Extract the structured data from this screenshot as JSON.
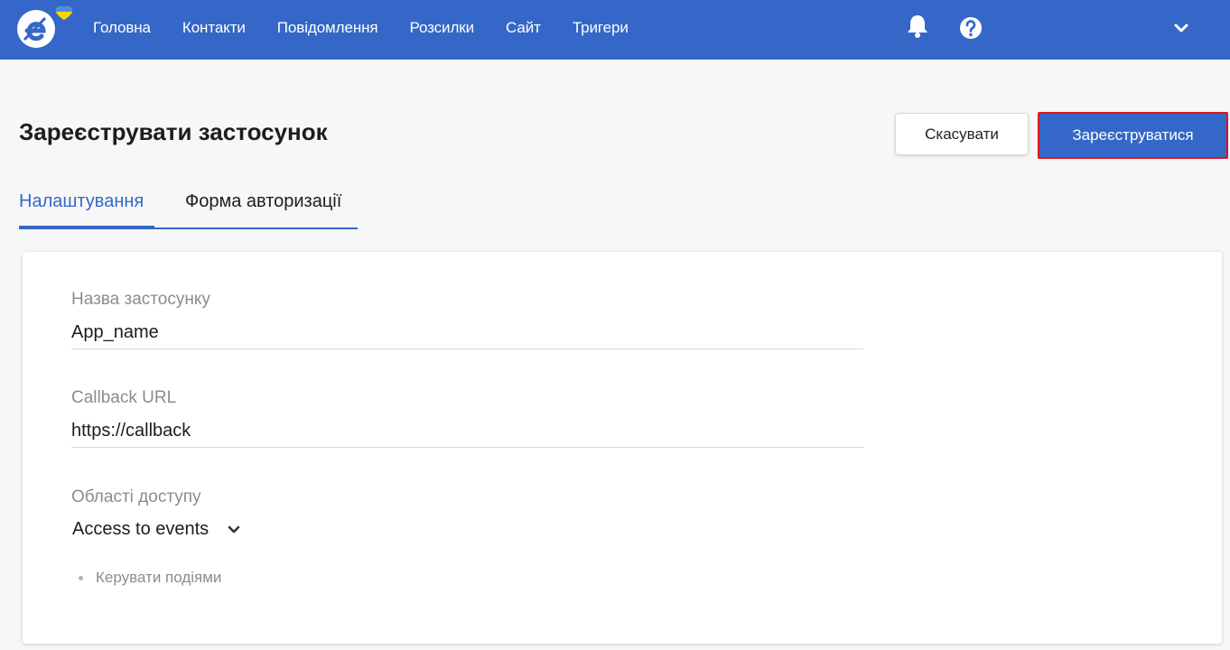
{
  "nav": {
    "items": [
      "Головна",
      "Контакти",
      "Повідомлення",
      "Розсилки",
      "Сайт",
      "Тригери"
    ]
  },
  "icons": {
    "logo": "esputnik-logo-icon",
    "notifications": "bell-icon",
    "help": "help-circle-icon",
    "account_menu": "chevron-down-icon"
  },
  "colors": {
    "brand": "#3467c7",
    "highlight_border": "#e0141e"
  },
  "page": {
    "title": "Зареєструвати застосунок",
    "cancel_label": "Скасувати",
    "register_label": "Зареєструватися"
  },
  "tabs": [
    {
      "label": "Налаштування",
      "active": true
    },
    {
      "label": "Форма авторизації",
      "active": false
    }
  ],
  "form": {
    "app_name": {
      "label": "Назва застосунку",
      "value": "App_name"
    },
    "callback": {
      "label": "Callback URL",
      "value": "https://callback"
    },
    "scopes": {
      "label": "Області доступу",
      "selected": "Access to events",
      "items": [
        "Керувати подіями"
      ]
    }
  }
}
